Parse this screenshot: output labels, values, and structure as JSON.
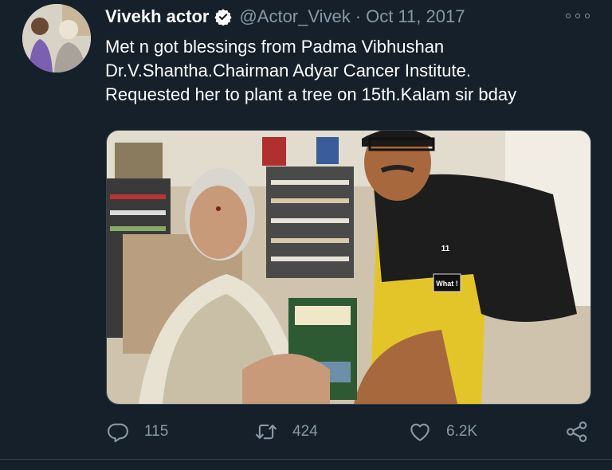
{
  "author": {
    "name": "Vivekh actor",
    "handle": "@Actor_Vivek",
    "separator": "·",
    "date": "Oct 11, 2017",
    "verified": true
  },
  "tweet": {
    "lines": [
      "Met n got blessings from Padma Vibhushan",
      "Dr.V.Shantha.Chairman Adyar Cancer Institute.",
      "Requested her to plant a tree on 15th.Kalam sir bday"
    ]
  },
  "media": {
    "shirt_badge": "What !",
    "shirt_number": "11"
  },
  "actions": {
    "reply_count": "115",
    "retweet_count": "424",
    "like_count": "6.2K"
  },
  "colors": {
    "background": "#15202b",
    "secondary_text": "#8899a6",
    "verified_badge": "#ffffff",
    "divider": "#38444d"
  },
  "icons": {
    "verified": "verified-badge-icon",
    "more": "more-options-icon",
    "reply": "reply-icon",
    "retweet": "retweet-icon",
    "like": "heart-icon",
    "share": "share-icon"
  }
}
